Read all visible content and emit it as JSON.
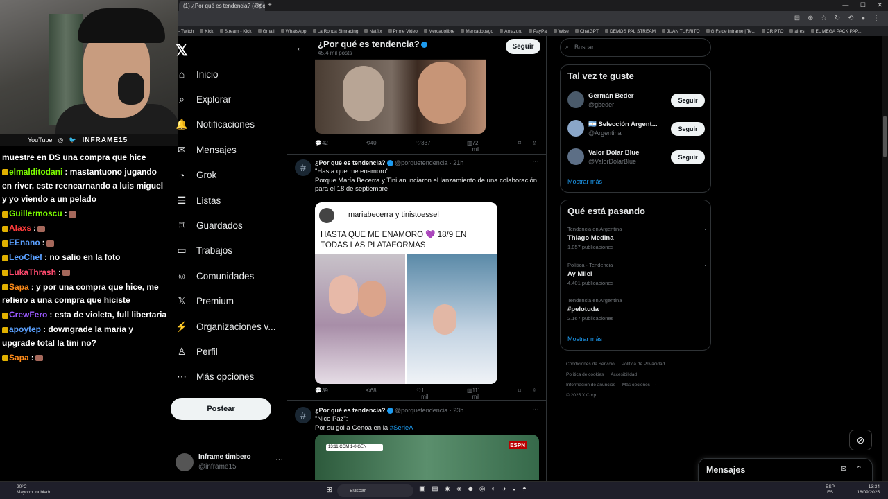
{
  "browser": {
    "tab_title": "(1) ¿Por qué es tendencia? (@po",
    "tab_close": "×",
    "new_tab": "+",
    "window_controls": "— ☐ ✕",
    "toolbar_icons": "⊟ ⊕ ☆ ↻ ⟲ ● ⋮",
    "bookmarks": [
      "- Twitch",
      "Kick",
      "Stream - Kick",
      "Gmail",
      "WhatsApp",
      "La Ronda Simracing",
      "Netflix",
      "Prime Video",
      "Mercadolibre",
      "Mercadopago",
      "Amazon.",
      "PayPal",
      "Wise",
      "ChatGPT",
      "DEMOS PAL STREAM",
      "JUAN TURRITO",
      "GIFs de Inframe | Te...",
      "CRIPTO",
      "aires",
      "EL MEGA PACK PAP..."
    ]
  },
  "webcam": {
    "socials": [
      "YouTube",
      "◎",
      "🐦"
    ],
    "channel": "INFRAME15"
  },
  "chat": [
    {
      "nick": "",
      "nick_color": "#ffffff",
      "text": "muestre en DS una compra que hice",
      "emote": false
    },
    {
      "nick": "elmalditodani",
      "nick_color": "#7cfc00",
      "text": ": mastantuono jugando en river, este reencarnando a luis miguel y yo viendo a un pelado",
      "emote": false
    },
    {
      "nick": "Guillermoscu",
      "nick_color": "#7cfc00",
      "text": ":",
      "emote": true
    },
    {
      "nick": "Alaxs",
      "nick_color": "#ff3b3b",
      "text": ":",
      "emote": true
    },
    {
      "nick": "EEnano",
      "nick_color": "#5aa0ff",
      "text": ":",
      "emote": true
    },
    {
      "nick": "LeoChef",
      "nick_color": "#5aa0ff",
      "text": ": no salio en la foto",
      "emote": false
    },
    {
      "nick": "LukaThrash",
      "nick_color": "#ff4a6e",
      "text": ":",
      "emote": true
    },
    {
      "nick": "Sapa",
      "nick_color": "#ff8c1a",
      "text": ": y por una compra que hice, me refiero a una compra que hiciste",
      "emote": false
    },
    {
      "nick": "CrewFero",
      "nick_color": "#9b59ff",
      "text": ": esta de violeta, full libertaria",
      "emote": false
    },
    {
      "nick": "apoytep",
      "nick_color": "#5aa0ff",
      "text": ": downgrade la maria y upgrade total la tini no?",
      "emote": false
    },
    {
      "nick": "Sapa",
      "nick_color": "#ff8c1a",
      "text": ":",
      "emote": true
    }
  ],
  "nav": {
    "logo": "𝕏",
    "items": [
      {
        "label": "Inicio",
        "icon": "⌂"
      },
      {
        "label": "Explorar",
        "icon": "⌕"
      },
      {
        "label": "Notificaciones",
        "icon": "🔔"
      },
      {
        "label": "Mensajes",
        "icon": "✉"
      },
      {
        "label": "Grok",
        "icon": "◔"
      },
      {
        "label": "Listas",
        "icon": "☰"
      },
      {
        "label": "Guardados",
        "icon": "⌑"
      },
      {
        "label": "Trabajos",
        "icon": "▭"
      },
      {
        "label": "Comunidades",
        "icon": "☺"
      },
      {
        "label": "Premium",
        "icon": "𝕏"
      },
      {
        "label": "Organizaciones v...",
        "icon": "⚡"
      },
      {
        "label": "Perfil",
        "icon": "♙"
      },
      {
        "label": "Más opciones",
        "icon": "⋯"
      }
    ],
    "post_button": "Postear",
    "account_name": "Inframe timbero",
    "account_handle": "@inframe15",
    "account_more": "···"
  },
  "feed": {
    "back": "←",
    "title": "¿Por qué es tendencia?",
    "subtitle": "45,4 mil posts",
    "follow": "Seguir",
    "tweet1_stats": {
      "replies": "42",
      "retweets": "40",
      "likes": "337",
      "views": "72 mil"
    },
    "tweet2": {
      "name": "¿Por qué es tendencia?",
      "handle": "@porquetendencia · 21h",
      "quote": "\"Hasta que me enamoro\":",
      "text": "Porque María Becerra y Tini anunciaron el lanzamiento de una colaboración para el 18 de septiembre",
      "card_user": "mariabecerra y tinistoessel",
      "card_caption": "HASTA QUE ME ENAMORO 💜 18/9 EN TODAS LAS PLATAFORMAS",
      "stats": {
        "replies": "39",
        "retweets": "68",
        "likes": "1 mil",
        "views": "111 mil"
      }
    },
    "tweet3": {
      "name": "¿Por qué es tendencia?",
      "handle": "@porquetendencia · 23h",
      "quote": "\"Nico Paz\":",
      "text": "Por su gol a Genoa en la ",
      "hashtag": "#SerieA",
      "scoreboard": "13:11  COM 1-0 GEN",
      "broadcaster": "ESPN"
    },
    "more_icon": "···",
    "hash_icon": "#"
  },
  "sidebar": {
    "search_placeholder": "Buscar",
    "suggestions_title": "Tal vez te guste",
    "suggestions": [
      {
        "name": "Germán Beder",
        "handle": "@gbeder",
        "button": "Seguir"
      },
      {
        "name": "🇦🇷 Selección Argent...",
        "handle": "@Argentina",
        "button": "Seguir"
      },
      {
        "name": "Valor Dólar Blue",
        "handle": "@ValorDolarBlue",
        "button": "Seguir"
      }
    ],
    "show_more": "Mostrar más",
    "trends_title": "Qué está pasando",
    "trends": [
      {
        "context": "Tendencia en Argentina",
        "topic": "Thiago Medina",
        "count": "1.857 publicaciones"
      },
      {
        "context": "Política · Tendencia",
        "topic": "Ay Milei",
        "count": "4.401 publicaciones"
      },
      {
        "context": "Tendencia en Argentina",
        "topic": "#pelotuda",
        "count": "2.167 publicaciones"
      }
    ],
    "trends_more": "Mostrar más",
    "footer": [
      "Condiciones de Servicio",
      "Política de Privacidad",
      "Política de cookies",
      "Accesibilidad",
      "Información de anuncios",
      "Más opciones ···",
      "© 2025 X Corp."
    ]
  },
  "dm": {
    "title": "Mensajes",
    "icons": "✉ ⌃"
  },
  "grok_icon": "⊘",
  "taskbar": {
    "weather_temp": "20°C",
    "weather_desc": "Mayorm. nublado",
    "search": "Buscar",
    "lang1": "ESP",
    "lang2": "ES",
    "time": "13:34",
    "date": "18/09/2025"
  }
}
